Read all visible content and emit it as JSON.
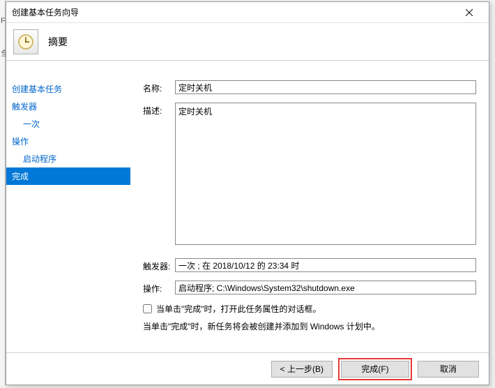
{
  "window": {
    "title": "创建基本任务向导"
  },
  "header": {
    "title": "摘要"
  },
  "sidebar": {
    "items": [
      {
        "label": "创建基本任务"
      },
      {
        "label": "触发器"
      },
      {
        "label": "一次"
      },
      {
        "label": "操作"
      },
      {
        "label": "启动程序"
      },
      {
        "label": "完成"
      }
    ]
  },
  "form": {
    "name_label": "名称:",
    "name_value": "定时关机",
    "desc_label": "描述:",
    "desc_value": "定时关机",
    "trigger_label": "触发器:",
    "trigger_value": "一次 ; 在 2018/10/12 的 23:34 时",
    "action_label": "操作:",
    "action_value": "启动程序; C:\\Windows\\System32\\shutdown.exe",
    "checkbox_label": "当单击\"完成\"时，打开此任务属性的对话框。",
    "info_text": "当单击\"完成\"时，新任务将会被创建并添加到 Windows 计划中。"
  },
  "buttons": {
    "back": "< 上一步(B)",
    "finish": "完成(F)",
    "cancel": "取消"
  }
}
